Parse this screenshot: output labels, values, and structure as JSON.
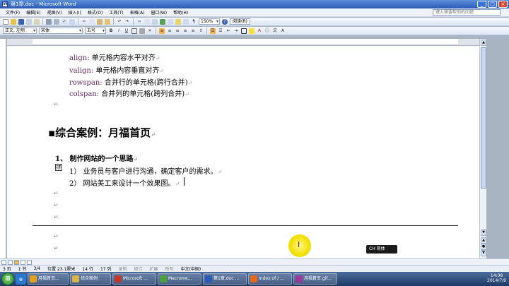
{
  "window": {
    "title": "第1章.doc - Microsoft Word",
    "minimize": "_",
    "maximize": "□",
    "close": "×"
  },
  "menu": {
    "items": [
      "文件(F)",
      "编辑(E)",
      "视图(V)",
      "插入(I)",
      "格式(O)",
      "工具(T)",
      "表格(A)",
      "窗口(W)",
      "帮助(H)"
    ],
    "help_placeholder": "键入需要帮助的问题"
  },
  "toolbar1": {
    "zoom": "150%",
    "read_label": "阅读(R)"
  },
  "toolbar2": {
    "style": "正文, 左侧",
    "font": "宋体",
    "size": "五号",
    "bold": "B",
    "italic": "I",
    "underline": "U"
  },
  "document": {
    "lines": [
      {
        "keyword": "align:",
        "text": " 单元格内容水平对齐"
      },
      {
        "keyword": "valign:",
        "text": " 单元格内容垂直对齐"
      },
      {
        "keyword": "rowspan:",
        "text": " 合并行的单元格(跨行合并)"
      },
      {
        "keyword": "colspan:",
        "text": " 合并列的单元格(跨列合并)"
      }
    ],
    "heading": "综合案例：月福首页",
    "subheading": "1、 制作网站的一个思路",
    "items": [
      "1） 业务员与客户进行沟通，确定客户的需求。",
      "2） 网站美工来设计一个效果图。"
    ],
    "smart_tag": "拼"
  },
  "overlay": {
    "label": "CH 简体"
  },
  "statusbar": {
    "page": "3 页",
    "section": "1 节",
    "pages": "3/4",
    "position": "位置 23.1厘米",
    "line": "14 行",
    "column": "17 列",
    "rec": "录制",
    "trk": "修订",
    "ext": "扩展",
    "ovr": "改写",
    "lang": "中文(中国)"
  },
  "taskbar": {
    "tasks": [
      {
        "label": "月福首页...",
        "color": "#e0a020"
      },
      {
        "label": "综合案例",
        "color": "#d9b24a"
      },
      {
        "label": "Microsoft ...",
        "color": "#c23a2a"
      },
      {
        "label": "Macrome...",
        "color": "#4aa040"
      },
      {
        "label": "第1章.doc ...",
        "color": "#2a5cb8"
      },
      {
        "label": "Index of / ...",
        "color": "#e06a1a"
      },
      {
        "label": "月福首页.gif...",
        "color": "#9a3a9a"
      }
    ],
    "time": "14:08",
    "date": "2014/7/9"
  }
}
